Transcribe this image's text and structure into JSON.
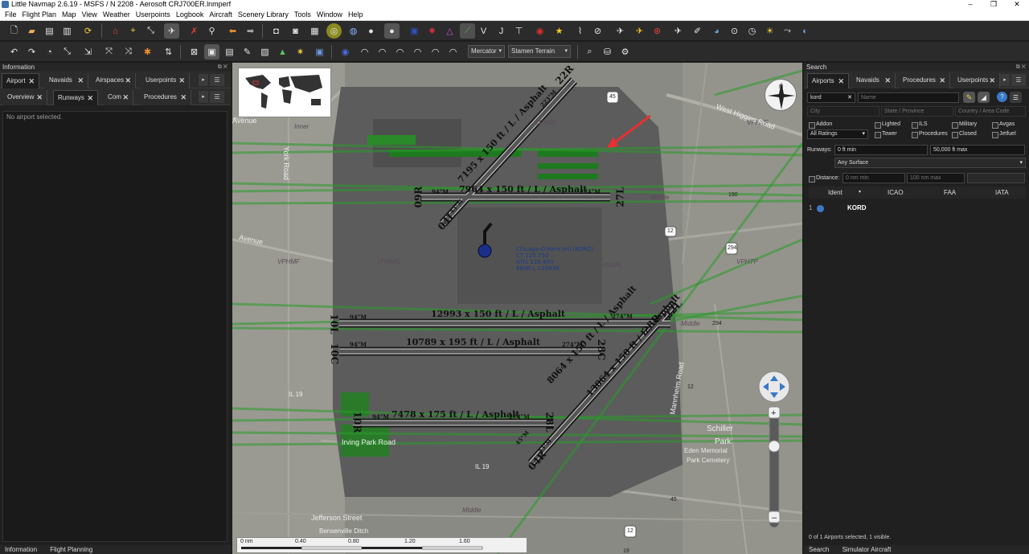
{
  "window": {
    "title": "Little Navmap 2.6.19 - MSFS / N 2208 - Aerosoft CRJ700ER.lnmperf",
    "minimize": "–",
    "maximize": "❐",
    "close": "✕"
  },
  "menu": [
    "File",
    "Flight Plan",
    "Map",
    "View",
    "Weather",
    "Userpoints",
    "Logbook",
    "Aircraft",
    "Scenery Library",
    "Tools",
    "Window",
    "Help"
  ],
  "toolbar": {
    "projection": "Mercator",
    "theme": "Stamen Terrain"
  },
  "left_panel": {
    "title": "Information",
    "tabs_top": [
      "Airport",
      "Navaids",
      "Airspaces",
      "Userpoints"
    ],
    "tabs_sub": [
      "Overview",
      "Runways",
      "Com",
      "Procedures"
    ],
    "empty_text": "No airport selected.",
    "bottom_tabs": [
      "Information",
      "Flight Planning"
    ]
  },
  "map": {
    "runways": {
      "r1": "12993 x 150 ft / L / Asphalt",
      "r2": "10789 x 195 ft / L / Asphalt",
      "r3": "7964 x 150 ft / L / Asphalt",
      "r4": "7478 x 175 ft / L / Asphalt",
      "r5": "8064 x 150 ft / L / Asphalt",
      "r6": "13064 x 150 ft / L / Asphalt",
      "r7": "7195 x 150 ft / L / Asphalt"
    },
    "runway_ends": {
      "e22r": "22R",
      "e09r": "09R",
      "e27l": "27L",
      "e04l": "04L",
      "e10l": "10L",
      "e10c": "10C",
      "e28c": "28C",
      "e28r": "28R",
      "e22l": "22L",
      "e10r": "10R",
      "e28l": "28L",
      "e04r": "04R"
    },
    "headings": {
      "h94a": "94°M",
      "h274a": "274°M",
      "h94b": "94°M",
      "h274b": "274°M",
      "h94c": "94°M",
      "h274c": "274°M",
      "h94d": "94°M",
      "h274d": "274°M",
      "h223": "223°M",
      "h43": "43°M",
      "h43b": "43°M",
      "h45": "45°M"
    },
    "airport_info": [
      "Chicago-O'Hare Intl (KORD)",
      "CT 120.750",
      "ATIS 135.400",
      "680ft L 12993ft"
    ],
    "place_labels": {
      "inner": "Inner",
      "middle1": "Middle",
      "middle2": "Middle",
      "middle3": "Middle",
      "middle4": "Middle",
      "vphmf": "VPHMF",
      "vphmg": "VPHMG",
      "vphge": "VPHGE",
      "vphtf": "VPHTF",
      "vphtp": "VPHTP",
      "schiller": "Schiller",
      "park": "Park",
      "eden1": "Eden Memorial",
      "eden2": "Park Cemetery",
      "irving": "Irving Park Road",
      "jefferson": "Jefferson Street",
      "bensenville": "Bensenville Ditch",
      "higgins": "West Higgins Road",
      "avenue1": "Avenue",
      "avenue2": "Avenue",
      "york": "York Road",
      "mannheim": "Mannheim Road",
      "il19a": "IL 19",
      "il19b": "IL 19",
      "r45": "45",
      "r12": "12",
      "r190": "190",
      "r294": "294",
      "r12b": "12",
      "r45b": "45",
      "r294b": "294",
      "r19": "19",
      "r12c": "12"
    },
    "scale": [
      "0 nm",
      "0.40",
      "0.80",
      "1.20",
      "1.60"
    ]
  },
  "right_panel": {
    "title": "Search",
    "tabs": [
      "Airports",
      "Navaids",
      "Procedures",
      "Userpoints"
    ],
    "ident_value": "kord",
    "name_placeholder": "Name",
    "city_placeholder": "City",
    "state_placeholder": "State / Province",
    "country_placeholder": "Country / Area Code",
    "checks": [
      "Addon",
      "Lighted",
      "ILS",
      "Military",
      "Avgas",
      "Tower",
      "Procedures",
      "Closed",
      "Jetfuel"
    ],
    "ratings": "All Ratings",
    "runways_label": "Runways:",
    "runway_min": "0 ft min",
    "runway_max": "50,000 ft max",
    "surface": "Any Surface",
    "distance_label": "Distance:",
    "distance_min": "0 nm min",
    "distance_max": "100 nm max",
    "columns": [
      "Ident",
      "ICAO",
      "FAA",
      "IATA"
    ],
    "row_index": "1",
    "row_ident": "KORD",
    "status": "0 of 1 Airports selected, 1 visible.",
    "bottom_tabs": [
      "Search",
      "Simulator Aircraft"
    ]
  }
}
